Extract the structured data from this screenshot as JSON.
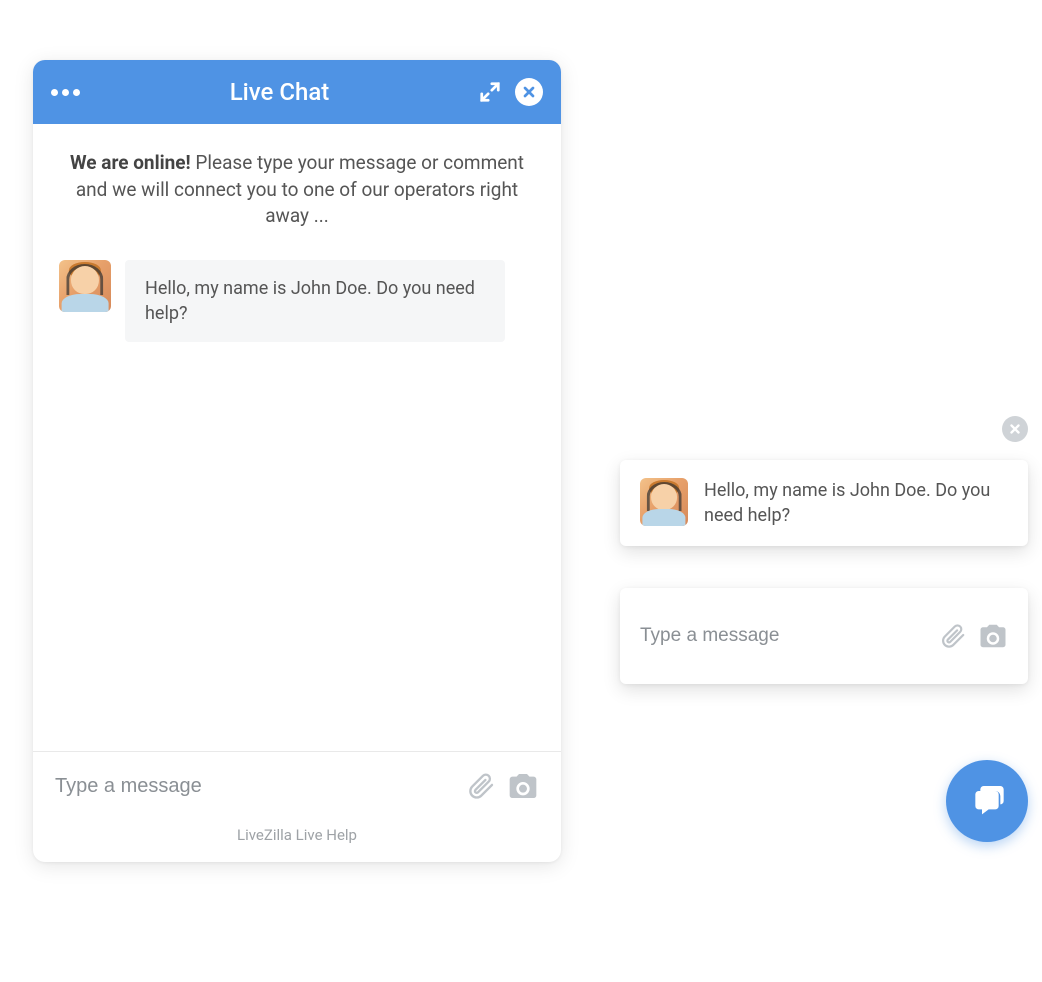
{
  "chatWindow": {
    "title": "Live Chat",
    "intro": {
      "bold": "We are online!",
      "rest": " Please type your message or comment and we will connect you to one of our operators right away ..."
    },
    "operatorMessage": "Hello, my name is John Doe. Do you need help?",
    "inputPlaceholder": "Type a message",
    "footer": "LiveZilla Live Help"
  },
  "popup": {
    "message": "Hello, my name is John Doe. Do you need help?",
    "inputPlaceholder": "Type a message"
  }
}
